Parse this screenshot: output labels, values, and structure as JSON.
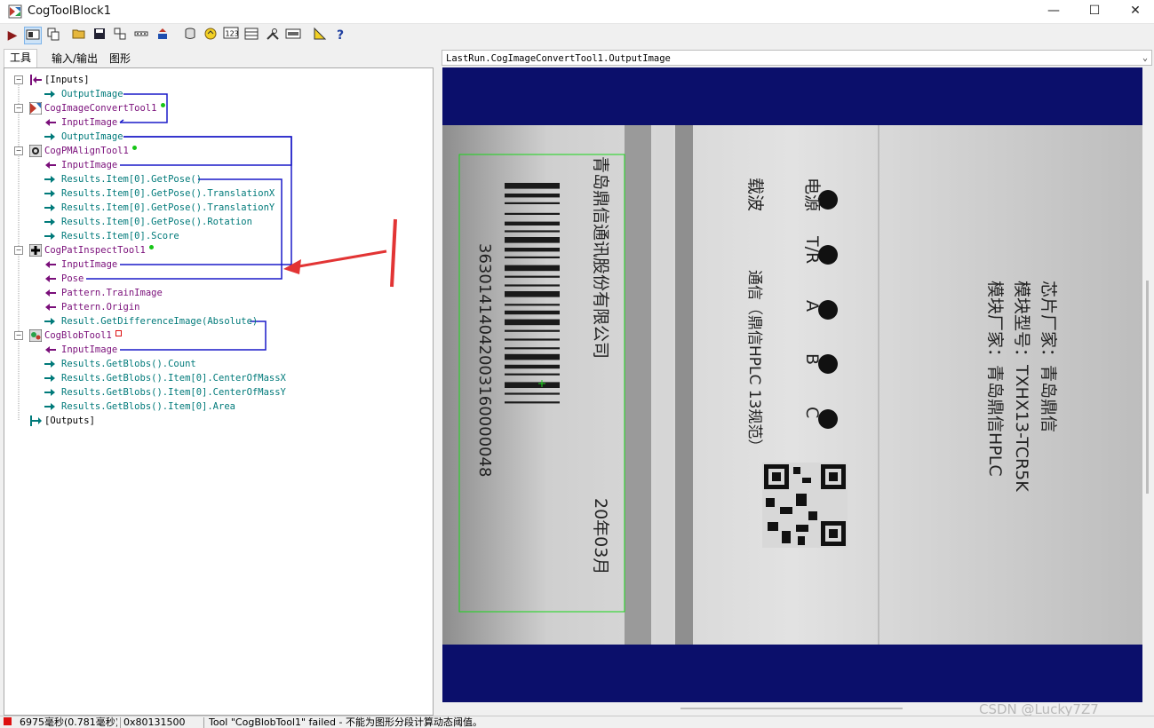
{
  "window": {
    "title": "CogToolBlock1",
    "minimize": "—",
    "maximize": "☐",
    "close": "✕"
  },
  "toolbar": {
    "buttons": [
      "run",
      "show-run",
      "copy",
      "open",
      "save",
      "windows",
      "dots",
      "import",
      "db",
      "refresh",
      "123",
      "grid",
      "tools",
      "dbg",
      "ruler",
      "help"
    ],
    "icons": {
      "run": "▶",
      "help": "?"
    }
  },
  "tabs": [
    "工具",
    "输入/输出",
    "图形"
  ],
  "tree": {
    "rows": [
      {
        "label": "[Inputs]",
        "color": "#000000"
      },
      {
        "label": "OutputImage",
        "color": "#007a7a"
      },
      {
        "label": "CogImageConvertTool1",
        "color": "#7a0f7a"
      },
      {
        "label": "InputImage",
        "color": "#7a0f7a"
      },
      {
        "label": "OutputImage",
        "color": "#007a7a"
      },
      {
        "label": "CogPMAlignTool1",
        "color": "#7a0f7a"
      },
      {
        "label": "InputImage",
        "color": "#7a0f7a"
      },
      {
        "label": "Results.Item[0].GetPose()",
        "color": "#007a7a"
      },
      {
        "label": "Results.Item[0].GetPose().TranslationX",
        "color": "#007a7a"
      },
      {
        "label": "Results.Item[0].GetPose().TranslationY",
        "color": "#007a7a"
      },
      {
        "label": "Results.Item[0].GetPose().Rotation",
        "color": "#007a7a"
      },
      {
        "label": "Results.Item[0].Score",
        "color": "#007a7a"
      },
      {
        "label": "CogPatInspectTool1",
        "color": "#7a0f7a"
      },
      {
        "label": "InputImage",
        "color": "#7a0f7a"
      },
      {
        "label": "Pose",
        "color": "#7a0f7a"
      },
      {
        "label": "Pattern.TrainImage",
        "color": "#7a0f7a"
      },
      {
        "label": "Pattern.Origin",
        "color": "#7a0f7a"
      },
      {
        "label": "Result.GetDifferenceImage(Absolute)",
        "color": "#007a7a"
      },
      {
        "label": "CogBlobTool1",
        "color": "#7a0f7a"
      },
      {
        "label": "InputImage",
        "color": "#7a0f7a"
      },
      {
        "label": "Results.GetBlobs().Count",
        "color": "#007a7a"
      },
      {
        "label": "Results.GetBlobs().Item[0].CenterOfMassX",
        "color": "#007a7a"
      },
      {
        "label": "Results.GetBlobs().Item[0].CenterOfMassY",
        "color": "#007a7a"
      },
      {
        "label": "Results.GetBlobs().Item[0].Area",
        "color": "#007a7a"
      },
      {
        "label": "[Outputs]",
        "color": "#000000"
      }
    ],
    "annotation": "1"
  },
  "image_view": {
    "selector": "LastRun.CogImageConvertTool1.OutputImage",
    "label_texts": {
      "company": "青岛鼎信通讯股份有限公司",
      "barcode_number": "36301414042003160000048",
      "date": "20年03月",
      "power": "电源",
      "carrier": "载波",
      "tr": "T/R",
      "a": "A",
      "b": "B",
      "c": "C",
      "comm": "通信（鼎信HPLC 13规范）",
      "maker": "模块厂家：青岛鼎信HPLC",
      "model": "模块型号：TXHX13-TCR5K",
      "chip": "芯片厂家：青岛鼎信"
    }
  },
  "status": {
    "timing": "6975毫秒(0.781毫秒)",
    "code": "0x80131500",
    "message": "Tool \"CogBlobTool1\" failed - 不能为图形分段计算动态阈值。"
  },
  "watermark": "CSDN @Lucky7Z7"
}
